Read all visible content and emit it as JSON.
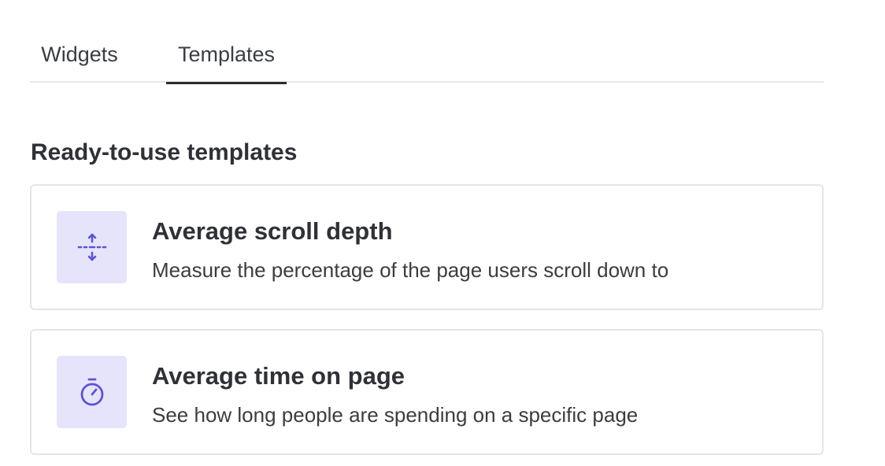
{
  "tabs": [
    {
      "label": "Widgets",
      "active": false
    },
    {
      "label": "Templates",
      "active": true
    }
  ],
  "section": {
    "title": "Ready-to-use templates"
  },
  "templates": [
    {
      "title": "Average scroll depth",
      "description": "Measure the percentage of the page users scroll down to",
      "icon": "scroll-depth-icon"
    },
    {
      "title": "Average time on page",
      "description": "See how long people are spending on a specific page",
      "icon": "stopwatch-icon"
    }
  ],
  "colors": {
    "icon_tile_bg": "#e6e4fb",
    "icon_accent": "#5b54d6",
    "active_tab_underline": "#2a2c30",
    "border": "#e4e5e8"
  }
}
